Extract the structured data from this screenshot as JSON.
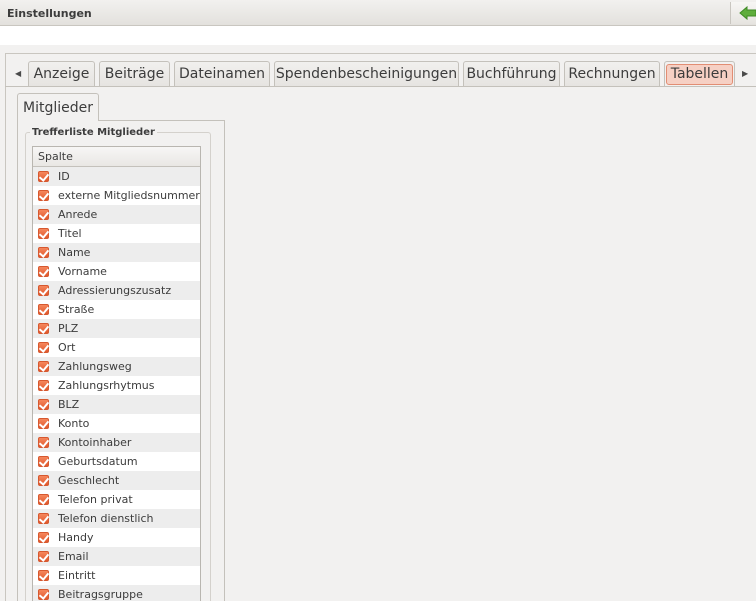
{
  "window": {
    "title": "Einstellungen"
  },
  "tabs": [
    {
      "label": "Anzeige"
    },
    {
      "label": "Beiträge"
    },
    {
      "label": "Dateinamen"
    },
    {
      "label": "Spendenbescheinigungen"
    },
    {
      "label": "Buchführung"
    },
    {
      "label": "Rechnungen"
    },
    {
      "label": "Tabellen",
      "active": true
    }
  ],
  "subtab": {
    "label": "Mitglieder"
  },
  "group": {
    "label": "Trefferliste Mitglieder"
  },
  "list": {
    "header": "Spalte",
    "rows": [
      {
        "label": "ID",
        "checked": true
      },
      {
        "label": "externe Mitgliedsnummer",
        "checked": true
      },
      {
        "label": "Anrede",
        "checked": true
      },
      {
        "label": "Titel",
        "checked": true
      },
      {
        "label": "Name",
        "checked": true
      },
      {
        "label": "Vorname",
        "checked": true
      },
      {
        "label": "Adressierungszusatz",
        "checked": true
      },
      {
        "label": "Straße",
        "checked": true
      },
      {
        "label": "PLZ",
        "checked": true
      },
      {
        "label": "Ort",
        "checked": true
      },
      {
        "label": "Zahlungsweg",
        "checked": true
      },
      {
        "label": "Zahlungsrhytmus",
        "checked": true
      },
      {
        "label": "BLZ",
        "checked": true
      },
      {
        "label": "Konto",
        "checked": true
      },
      {
        "label": "Kontoinhaber",
        "checked": true
      },
      {
        "label": "Geburtsdatum",
        "checked": true
      },
      {
        "label": "Geschlecht",
        "checked": true
      },
      {
        "label": "Telefon privat",
        "checked": true
      },
      {
        "label": "Telefon dienstlich",
        "checked": true
      },
      {
        "label": "Handy",
        "checked": true
      },
      {
        "label": "Email",
        "checked": true
      },
      {
        "label": "Eintritt",
        "checked": true
      },
      {
        "label": "Beitragsgruppe",
        "checked": true
      }
    ]
  },
  "colors": {
    "accent": "#e0572b",
    "active_tab_bg": "#f6d0c4",
    "back_arrow": "#5fae3c"
  },
  "icons": {
    "back": "back-arrow-icon",
    "scroll_left": "triangle-left-icon",
    "scroll_right": "triangle-right-icon",
    "checkbox": "checkbox-checked-icon"
  }
}
